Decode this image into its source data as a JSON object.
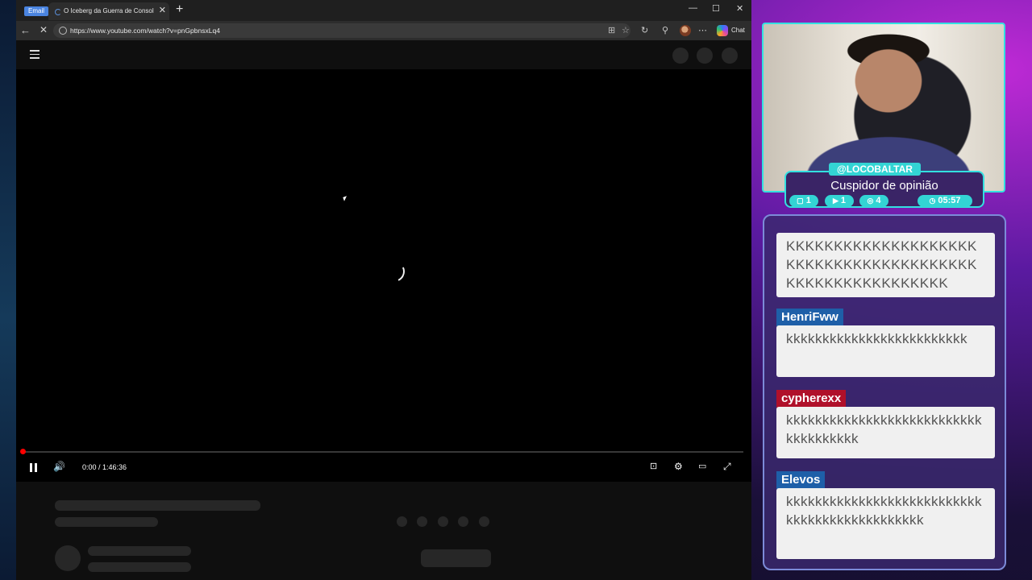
{
  "browser": {
    "email_pill": "Email",
    "tab_title": "O Iceberg da Guerra de Consoles",
    "url": "https://www.youtube.com/watch?v=pnGpbnsxLq4",
    "chat_label": "Chat"
  },
  "player": {
    "time": "0:00 / 1:46:36",
    "progress_fraction": 0.0
  },
  "stream": {
    "handle": "@LOCOBALTAR",
    "subtitle": "Cuspidor de opinião",
    "stats": [
      {
        "icon": "twitch-icon",
        "value": "1"
      },
      {
        "icon": "youtube-icon",
        "value": "1"
      },
      {
        "icon": "kick-icon",
        "value": "4"
      },
      {
        "icon": "clock-icon",
        "value": "05:57"
      }
    ],
    "accent_color": "#33e0e0"
  },
  "chat": {
    "messages": [
      {
        "user": "",
        "user_color": "",
        "text": "KKKKKKKKKKKKKKKKKKKKKKKKKKKKKKKKKKKKKKKKKKKKKKKKKKKKKKKKK"
      },
      {
        "user": "HenriFww",
        "user_color": "#1e5fa8",
        "text": "kkkkkkkkkkkkkkkkkkkkkkkkk"
      },
      {
        "user": "cypherexx",
        "user_color": "#b0102a",
        "text": "kkkkkkkkkkkkkkkkkkkkkkkkkkkkkkkkkkkkk"
      },
      {
        "user": "Elevos",
        "user_color": "#1e5fa8",
        "text": "kkkkkkkkkkkkkkkkkkkkkkkkkkkkkkkkkkkkkkkkkkkkkk"
      }
    ]
  }
}
